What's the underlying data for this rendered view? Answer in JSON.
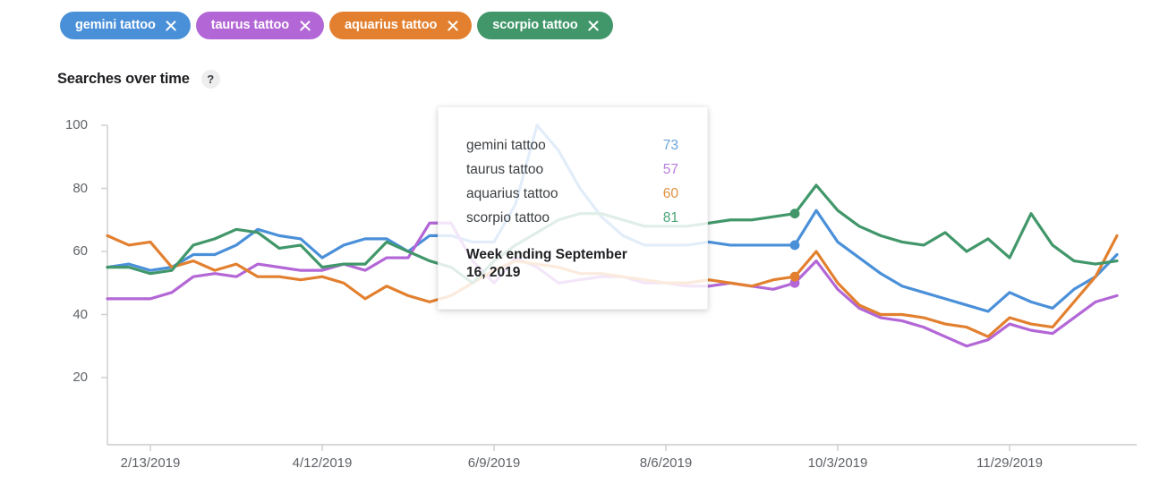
{
  "chips": [
    {
      "label": "gemini tattoo",
      "color": "#4a90d9",
      "close_icon": "close-icon"
    },
    {
      "label": "taurus tattoo",
      "color": "#b濾"
    },
    {
      "label": "aquarius tattoo",
      "color": "#e2802f"
    },
    {
      "label": "scorpio tattoo",
      "color": "#41976a"
    }
  ],
  "section": {
    "title": "Searches over time",
    "help_label": "?"
  },
  "tooltip": {
    "rows": [
      {
        "name": "gemini tattoo",
        "value": "73",
        "color": "#6ba4dd"
      },
      {
        "name": "taurus tattoo",
        "value": "57",
        "color": "#b77ee0"
      },
      {
        "name": "aquarius tattoo",
        "value": "60",
        "color": "#e0913f"
      },
      {
        "name": "scorpio tattoo",
        "value": "81",
        "color": "#4aa578"
      }
    ],
    "date": "Week ending September 16, 2019"
  },
  "chart_data": {
    "type": "line",
    "title": "Searches over time",
    "xlabel": "",
    "ylabel": "",
    "ylim": [
      0,
      100
    ],
    "yticks": [
      20,
      40,
      60,
      80,
      100
    ],
    "grid": false,
    "legend": "chips-top",
    "xticks": [
      "2/13/2019",
      "4/12/2019",
      "6/9/2019",
      "8/6/2019",
      "10/3/2019",
      "11/29/2019"
    ],
    "xtick_index": [
      2,
      10,
      18,
      26,
      34,
      42
    ],
    "highlight_index": 32,
    "highlight_label": "Week ending September 16, 2019",
    "x": [
      "1/27/2019",
      "2/3/2019",
      "2/10/2019",
      "2/17/2019",
      "2/24/2019",
      "3/3/2019",
      "3/10/2019",
      "3/17/2019",
      "3/24/2019",
      "3/31/2019",
      "4/7/2019",
      "4/14/2019",
      "4/21/2019",
      "4/28/2019",
      "5/5/2019",
      "5/12/2019",
      "5/19/2019",
      "5/26/2019",
      "6/2/2019",
      "6/9/2019",
      "6/16/2019",
      "6/23/2019",
      "6/30/2019",
      "7/7/2019",
      "7/14/2019",
      "7/21/2019",
      "7/28/2019",
      "8/4/2019",
      "8/11/2019",
      "8/18/2019",
      "8/25/2019",
      "9/1/2019",
      "9/8/2019",
      "9/15/2019",
      "9/22/2019",
      "9/29/2019",
      "10/6/2019",
      "10/13/2019",
      "10/20/2019",
      "10/27/2019",
      "11/3/2019",
      "11/10/2019",
      "11/17/2019",
      "11/24/2019",
      "12/1/2019",
      "12/8/2019",
      "12/15/2019",
      "12/22/2019"
    ],
    "series": [
      {
        "name": "gemini tattoo",
        "color": "#4a90d9",
        "values": [
          55,
          56,
          54,
          55,
          59,
          59,
          62,
          67,
          65,
          64,
          58,
          62,
          64,
          64,
          60,
          65,
          65,
          63,
          63,
          75,
          100,
          92,
          80,
          71,
          65,
          62,
          62,
          62,
          63,
          62,
          62,
          62,
          62,
          73,
          63,
          58,
          53,
          49,
          47,
          45,
          43,
          41,
          47,
          44,
          42,
          48,
          52,
          59
        ]
      },
      {
        "name": "taurus tattoo",
        "color": "#b367d6",
        "values": [
          45,
          45,
          45,
          47,
          52,
          53,
          52,
          56,
          55,
          54,
          54,
          56,
          54,
          58,
          58,
          69,
          69,
          57,
          50,
          58,
          55,
          50,
          51,
          52,
          52,
          50,
          50,
          49,
          49,
          50,
          49,
          48,
          50,
          57,
          48,
          42,
          39,
          38,
          36,
          33,
          30,
          32,
          37,
          35,
          34,
          39,
          44,
          46
        ]
      },
      {
        "name": "aquarius tattoo",
        "color": "#e2802f",
        "values": [
          65,
          62,
          63,
          55,
          57,
          54,
          56,
          52,
          52,
          51,
          52,
          50,
          45,
          49,
          46,
          44,
          46,
          50,
          54,
          57,
          56,
          55,
          53,
          53,
          52,
          51,
          50,
          50,
          51,
          50,
          49,
          51,
          52,
          60,
          50,
          43,
          40,
          40,
          39,
          37,
          36,
          33,
          39,
          37,
          36,
          44,
          52,
          65
        ]
      },
      {
        "name": "scorpio tattoo",
        "color": "#41976a",
        "values": [
          55,
          55,
          53,
          54,
          62,
          64,
          67,
          66,
          61,
          62,
          55,
          56,
          56,
          63,
          60,
          57,
          55,
          50,
          57,
          62,
          66,
          70,
          72,
          72,
          70,
          68,
          68,
          68,
          69,
          70,
          70,
          71,
          72,
          81,
          73,
          68,
          65,
          63,
          62,
          66,
          60,
          64,
          58,
          72,
          62,
          57,
          56,
          57
        ]
      }
    ]
  },
  "axis_colors": {
    "tick_text": "#5f6368",
    "axis_line": "#cccccc"
  }
}
